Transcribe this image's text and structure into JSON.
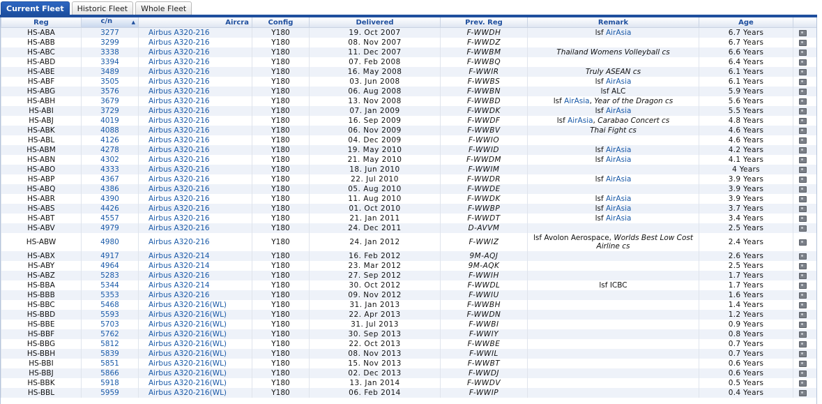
{
  "tabs": [
    {
      "label": "Current Fleet",
      "active": true
    },
    {
      "label": "Historic Fleet",
      "active": false
    },
    {
      "label": "Whole Fleet",
      "active": false
    }
  ],
  "table": {
    "columns": [
      "Reg",
      "c/n",
      "Aircra",
      "Config",
      "Delivered",
      "Prev. Reg",
      "Remark",
      "Age",
      ""
    ],
    "sorted_column": "c/n",
    "sort_icon": "sort-arrow-icon",
    "photo_icon": "camera-icon",
    "rows": [
      {
        "reg": "HS-ABA",
        "cn": "3277",
        "aircraft": "Airbus A320-216",
        "config": "Y180",
        "delivered": "19. Oct 2007",
        "prev": "F-WWDH",
        "remark": [
          {
            "t": "lsf "
          },
          {
            "t": "AirAsia",
            "k": "link"
          }
        ],
        "age": "6.7 Years"
      },
      {
        "reg": "HS-ABB",
        "cn": "3299",
        "aircraft": "Airbus A320-216",
        "config": "Y180",
        "delivered": "08. Nov 2007",
        "prev": "F-WWDZ",
        "remark": [],
        "age": "6.7 Years"
      },
      {
        "reg": "HS-ABC",
        "cn": "3338",
        "aircraft": "Airbus A320-216",
        "config": "Y180",
        "delivered": "11. Dec 2007",
        "prev": "F-WWBM",
        "remark": [
          {
            "t": "Thailand Womens Volleyball cs",
            "k": "italic"
          }
        ],
        "age": "6.6 Years"
      },
      {
        "reg": "HS-ABD",
        "cn": "3394",
        "aircraft": "Airbus A320-216",
        "config": "Y180",
        "delivered": "07. Feb 2008",
        "prev": "F-WWBQ",
        "remark": [],
        "age": "6.4 Years"
      },
      {
        "reg": "HS-ABE",
        "cn": "3489",
        "aircraft": "Airbus A320-216",
        "config": "Y180",
        "delivered": "16. May 2008",
        "prev": "F-WWIR",
        "remark": [
          {
            "t": "Truly ASEAN cs",
            "k": "italic"
          }
        ],
        "age": "6.1 Years"
      },
      {
        "reg": "HS-ABF",
        "cn": "3505",
        "aircraft": "Airbus A320-216",
        "config": "Y180",
        "delivered": "03. Jun 2008",
        "prev": "F-WWBS",
        "remark": [
          {
            "t": "lsf "
          },
          {
            "t": "AirAsia",
            "k": "link"
          }
        ],
        "age": "6.1 Years"
      },
      {
        "reg": "HS-ABG",
        "cn": "3576",
        "aircraft": "Airbus A320-216",
        "config": "Y180",
        "delivered": "06. Aug 2008",
        "prev": "F-WWBN",
        "remark": [
          {
            "t": "lsf ALC"
          }
        ],
        "age": "5.9 Years"
      },
      {
        "reg": "HS-ABH",
        "cn": "3679",
        "aircraft": "Airbus A320-216",
        "config": "Y180",
        "delivered": "13. Nov 2008",
        "prev": "F-WWBD",
        "remark": [
          {
            "t": "lsf "
          },
          {
            "t": "AirAsia",
            "k": "link"
          },
          {
            "t": ", "
          },
          {
            "t": "Year of the Dragon cs",
            "k": "italic"
          }
        ],
        "age": "5.6 Years"
      },
      {
        "reg": "HS-ABI",
        "cn": "3729",
        "aircraft": "Airbus A320-216",
        "config": "Y180",
        "delivered": "07. Jan 2009",
        "prev": "F-WWDK",
        "remark": [
          {
            "t": "lsf "
          },
          {
            "t": "AirAsia",
            "k": "link"
          }
        ],
        "age": "5.5 Years"
      },
      {
        "reg": "HS-ABJ",
        "cn": "4019",
        "aircraft": "Airbus A320-216",
        "config": "Y180",
        "delivered": "16. Sep 2009",
        "prev": "F-WWDF",
        "remark": [
          {
            "t": "lsf "
          },
          {
            "t": "AirAsia",
            "k": "link"
          },
          {
            "t": ", "
          },
          {
            "t": "Carabao Concert cs",
            "k": "italic"
          }
        ],
        "age": "4.8 Years"
      },
      {
        "reg": "HS-ABK",
        "cn": "4088",
        "aircraft": "Airbus A320-216",
        "config": "Y180",
        "delivered": "06. Nov 2009",
        "prev": "F-WWBV",
        "remark": [
          {
            "t": "Thai Fight cs",
            "k": "italic"
          }
        ],
        "age": "4.6 Years"
      },
      {
        "reg": "HS-ABL",
        "cn": "4126",
        "aircraft": "Airbus A320-216",
        "config": "Y180",
        "delivered": "04. Dec 2009",
        "prev": "F-WWIO",
        "remark": [],
        "age": "4.6 Years"
      },
      {
        "reg": "HS-ABM",
        "cn": "4278",
        "aircraft": "Airbus A320-216",
        "config": "Y180",
        "delivered": "19. May 2010",
        "prev": "F-WWID",
        "remark": [
          {
            "t": "lsf "
          },
          {
            "t": "AirAsia",
            "k": "link"
          }
        ],
        "age": "4.2 Years"
      },
      {
        "reg": "HS-ABN",
        "cn": "4302",
        "aircraft": "Airbus A320-216",
        "config": "Y180",
        "delivered": "21. May 2010",
        "prev": "F-WWDM",
        "remark": [
          {
            "t": "lsf "
          },
          {
            "t": "AirAsia",
            "k": "link"
          }
        ],
        "age": "4.1 Years"
      },
      {
        "reg": "HS-ABO",
        "cn": "4333",
        "aircraft": "Airbus A320-216",
        "config": "Y180",
        "delivered": "18. Jun 2010",
        "prev": "F-WWIM",
        "remark": [],
        "age": "4 Years"
      },
      {
        "reg": "HS-ABP",
        "cn": "4367",
        "aircraft": "Airbus A320-216",
        "config": "Y180",
        "delivered": "22. Jul 2010",
        "prev": "F-WWDR",
        "remark": [
          {
            "t": "lsf "
          },
          {
            "t": "AirAsia",
            "k": "link"
          }
        ],
        "age": "3.9 Years"
      },
      {
        "reg": "HS-ABQ",
        "cn": "4386",
        "aircraft": "Airbus A320-216",
        "config": "Y180",
        "delivered": "05. Aug 2010",
        "prev": "F-WWDE",
        "remark": [],
        "age": "3.9 Years"
      },
      {
        "reg": "HS-ABR",
        "cn": "4390",
        "aircraft": "Airbus A320-216",
        "config": "Y180",
        "delivered": "11. Aug 2010",
        "prev": "F-WWDK",
        "remark": [
          {
            "t": "lsf "
          },
          {
            "t": "AirAsia",
            "k": "link"
          }
        ],
        "age": "3.9 Years"
      },
      {
        "reg": "HS-ABS",
        "cn": "4426",
        "aircraft": "Airbus A320-216",
        "config": "Y180",
        "delivered": "01. Oct 2010",
        "prev": "F-WWBP",
        "remark": [
          {
            "t": "lsf "
          },
          {
            "t": "AirAsia",
            "k": "link"
          }
        ],
        "age": "3.7 Years"
      },
      {
        "reg": "HS-ABT",
        "cn": "4557",
        "aircraft": "Airbus A320-216",
        "config": "Y180",
        "delivered": "21. Jan 2011",
        "prev": "F-WWDT",
        "remark": [
          {
            "t": "lsf "
          },
          {
            "t": "AirAsia",
            "k": "link"
          }
        ],
        "age": "3.4 Years"
      },
      {
        "reg": "HS-ABV",
        "cn": "4979",
        "aircraft": "Airbus A320-216",
        "config": "Y180",
        "delivered": "24. Dec 2011",
        "prev": "D-AVVM",
        "remark": [],
        "age": "2.5 Years"
      },
      {
        "reg": "HS-ABW",
        "cn": "4980",
        "aircraft": "Airbus A320-216",
        "config": "Y180",
        "delivered": "24. Jan 2012",
        "prev": "F-WWIZ",
        "remark": [
          {
            "t": "lsf Avolon Aerospace, "
          },
          {
            "t": "Worlds Best Low Cost Airline cs",
            "k": "italic"
          }
        ],
        "age": "2.4 Years",
        "tall": true
      },
      {
        "reg": "HS-ABX",
        "cn": "4917",
        "aircraft": "Airbus A320-214",
        "config": "Y180",
        "delivered": "16. Feb 2012",
        "prev": "9M-AQJ",
        "remark": [],
        "age": "2.6 Years"
      },
      {
        "reg": "HS-ABY",
        "cn": "4964",
        "aircraft": "Airbus A320-214",
        "config": "Y180",
        "delivered": "23. Mar 2012",
        "prev": "9M-AQK",
        "remark": [],
        "age": "2.5 Years"
      },
      {
        "reg": "HS-ABZ",
        "cn": "5283",
        "aircraft": "Airbus A320-216",
        "config": "Y180",
        "delivered": "27. Sep 2012",
        "prev": "F-WWIH",
        "remark": [],
        "age": "1.7 Years"
      },
      {
        "reg": "HS-BBA",
        "cn": "5344",
        "aircraft": "Airbus A320-214",
        "config": "Y180",
        "delivered": "30. Oct 2012",
        "prev": "F-WWDL",
        "remark": [
          {
            "t": "lsf ICBC"
          }
        ],
        "age": "1.7 Years"
      },
      {
        "reg": "HS-BBB",
        "cn": "5353",
        "aircraft": "Airbus A320-216",
        "config": "Y180",
        "delivered": "09. Nov 2012",
        "prev": "F-WWIU",
        "remark": [],
        "age": "1.6 Years"
      },
      {
        "reg": "HS-BBC",
        "cn": "5468",
        "aircraft": "Airbus A320-216(WL)",
        "config": "Y180",
        "delivered": "31. Jan 2013",
        "prev": "F-WWBH",
        "remark": [],
        "age": "1.4 Years"
      },
      {
        "reg": "HS-BBD",
        "cn": "5593",
        "aircraft": "Airbus A320-216(WL)",
        "config": "Y180",
        "delivered": "22. Apr 2013",
        "prev": "F-WWDN",
        "remark": [],
        "age": "1.2 Years"
      },
      {
        "reg": "HS-BBE",
        "cn": "5703",
        "aircraft": "Airbus A320-216(WL)",
        "config": "Y180",
        "delivered": "31. Jul 2013",
        "prev": "F-WWBI",
        "remark": [],
        "age": "0.9 Years"
      },
      {
        "reg": "HS-BBF",
        "cn": "5762",
        "aircraft": "Airbus A320-216(WL)",
        "config": "Y180",
        "delivered": "30. Sep 2013",
        "prev": "F-WWIY",
        "remark": [],
        "age": "0.8 Years"
      },
      {
        "reg": "HS-BBG",
        "cn": "5812",
        "aircraft": "Airbus A320-216(WL)",
        "config": "Y180",
        "delivered": "22. Oct 2013",
        "prev": "F-WWBE",
        "remark": [],
        "age": "0.7 Years"
      },
      {
        "reg": "HS-BBH",
        "cn": "5839",
        "aircraft": "Airbus A320-216(WL)",
        "config": "Y180",
        "delivered": "08. Nov 2013",
        "prev": "F-WWIL",
        "remark": [],
        "age": "0.7 Years"
      },
      {
        "reg": "HS-BBI",
        "cn": "5851",
        "aircraft": "Airbus A320-216(WL)",
        "config": "Y180",
        "delivered": "15. Nov 2013",
        "prev": "F-WWBT",
        "remark": [],
        "age": "0.6 Years"
      },
      {
        "reg": "HS-BBJ",
        "cn": "5866",
        "aircraft": "Airbus A320-216(WL)",
        "config": "Y180",
        "delivered": "02. Dec 2013",
        "prev": "F-WWDJ",
        "remark": [],
        "age": "0.6 Years"
      },
      {
        "reg": "HS-BBK",
        "cn": "5918",
        "aircraft": "Airbus A320-216(WL)",
        "config": "Y180",
        "delivered": "13. Jan 2014",
        "prev": "F-WWDV",
        "remark": [],
        "age": "0.5 Years"
      },
      {
        "reg": "HS-BBL",
        "cn": "5959",
        "aircraft": "Airbus A320-216(WL)",
        "config": "Y180",
        "delivered": "06. Feb 2014",
        "prev": "F-WWIP",
        "remark": [],
        "age": "0.4 Years"
      }
    ]
  },
  "colors": {
    "accent": "#1f4f9e",
    "link": "#1a5aa8",
    "row_alt": "#eef2f9"
  }
}
